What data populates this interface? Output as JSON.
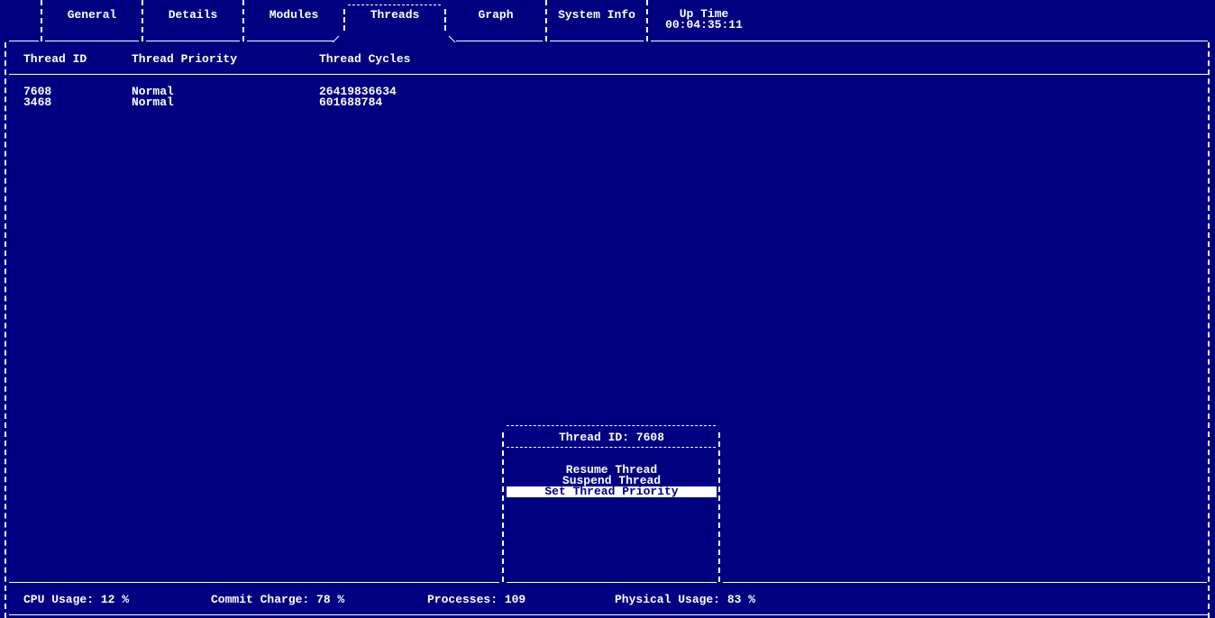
{
  "tabs": [
    {
      "label": "General"
    },
    {
      "label": "Details"
    },
    {
      "label": "Modules"
    },
    {
      "label": "Threads",
      "active": true
    },
    {
      "label": "Graph"
    },
    {
      "label": "System Info"
    }
  ],
  "uptime": {
    "label": "Up Time",
    "value": "00:04:35:11"
  },
  "table": {
    "columns": [
      "Thread ID",
      "Thread Priority",
      "Thread Cycles"
    ],
    "rows": [
      {
        "id": "7608",
        "priority": "Normal",
        "cycles": "26419836634"
      },
      {
        "id": "3468",
        "priority": "Normal",
        "cycles": "601688784"
      }
    ]
  },
  "popup": {
    "title": "Thread ID: 7608",
    "items": [
      "Resume Thread",
      "Suspend Thread",
      "Set Thread Priority"
    ],
    "selected_index": 2
  },
  "status": {
    "cpu": "CPU Usage: 12 %",
    "commit": "Commit Charge: 78 %",
    "processes": "Processes: 109",
    "physical": "Physical Usage: 83 %"
  },
  "colors": {
    "background": "#000080",
    "foreground": "#ffffff"
  }
}
